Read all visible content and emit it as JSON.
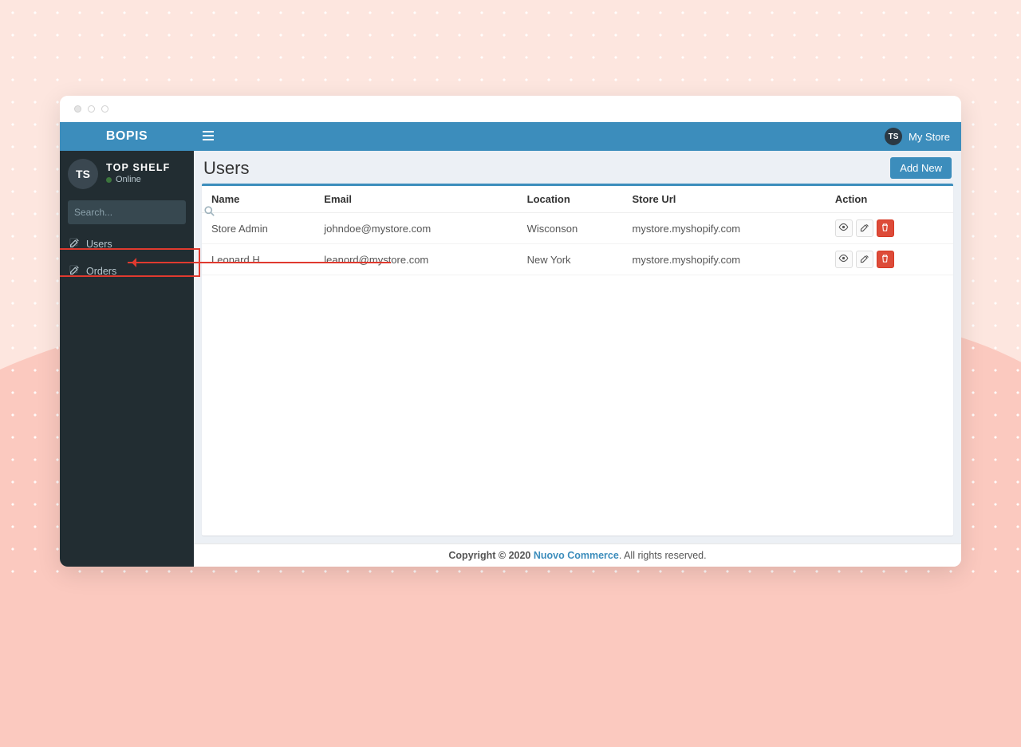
{
  "brand": "BOPIS",
  "top": {
    "store_avatar": "TS",
    "store_label": "My Store"
  },
  "sidebar": {
    "user": {
      "avatar": "TS",
      "name": "TOP SHELF",
      "status": "Online"
    },
    "search_placeholder": "Search...",
    "items": [
      {
        "label": "Users",
        "active": true
      },
      {
        "label": "Orders",
        "active": false
      }
    ]
  },
  "page": {
    "title": "Users",
    "add_button": "Add New",
    "columns": {
      "name": "Name",
      "email": "Email",
      "location": "Location",
      "url": "Store Url",
      "action": "Action"
    },
    "rows": [
      {
        "name": "Store Admin",
        "email": "johndoe@mystore.com",
        "location": "Wisconson",
        "url": "mystore.myshopify.com"
      },
      {
        "name": "Leonard H",
        "email": "leanord@mystore.com",
        "location": "New York",
        "url": "mystore.myshopify.com"
      }
    ]
  },
  "footer": {
    "prefix": "Copyright © 2020 ",
    "link": "Nuovo Commerce",
    "suffix": ". All rights reserved."
  }
}
